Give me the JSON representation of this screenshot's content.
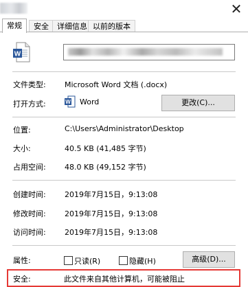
{
  "window": {
    "close_glyph": "✕"
  },
  "tabs": [
    {
      "label": "常规",
      "active": true
    },
    {
      "label": "安全",
      "active": false
    },
    {
      "label": "详细信息",
      "active": false
    },
    {
      "label": "以前的版本",
      "active": false
    }
  ],
  "file_icon": {
    "name": "word-doc-icon",
    "letter": "W",
    "color": "#2b579a"
  },
  "rows": {
    "file_type_label": "文件类型:",
    "file_type_value": "Microsoft Word 文档 (.docx)",
    "open_with_label": "打开方式:",
    "open_with_app": "Word",
    "change_button": "更改(C)...",
    "location_label": "位置:",
    "location_value": "C:\\Users\\Administrator\\Desktop",
    "size_label": "大小:",
    "size_value": "40.5 KB (41,485 字节)",
    "size_on_disk_label": "占用空间:",
    "size_on_disk_value": "48.0 KB (49,152 字节)",
    "created_label": "创建时间:",
    "created_value": "2019年7月15日，9:13:08",
    "modified_label": "修改时间:",
    "modified_value": "2019年7月15日，9:13:08",
    "accessed_label": "访问时间:",
    "accessed_value": "2019年7月15日，9:13:08",
    "attributes_label": "属性:",
    "readonly_label": "只读(R)",
    "hidden_label": "隐藏(H)",
    "advanced_button": "高级(D)...",
    "security_label": "安全:",
    "security_text": "此文件来自其他计算机，可能被阻止"
  },
  "colors": {
    "highlight": "#e53935",
    "word_blue": "#2b579a"
  }
}
